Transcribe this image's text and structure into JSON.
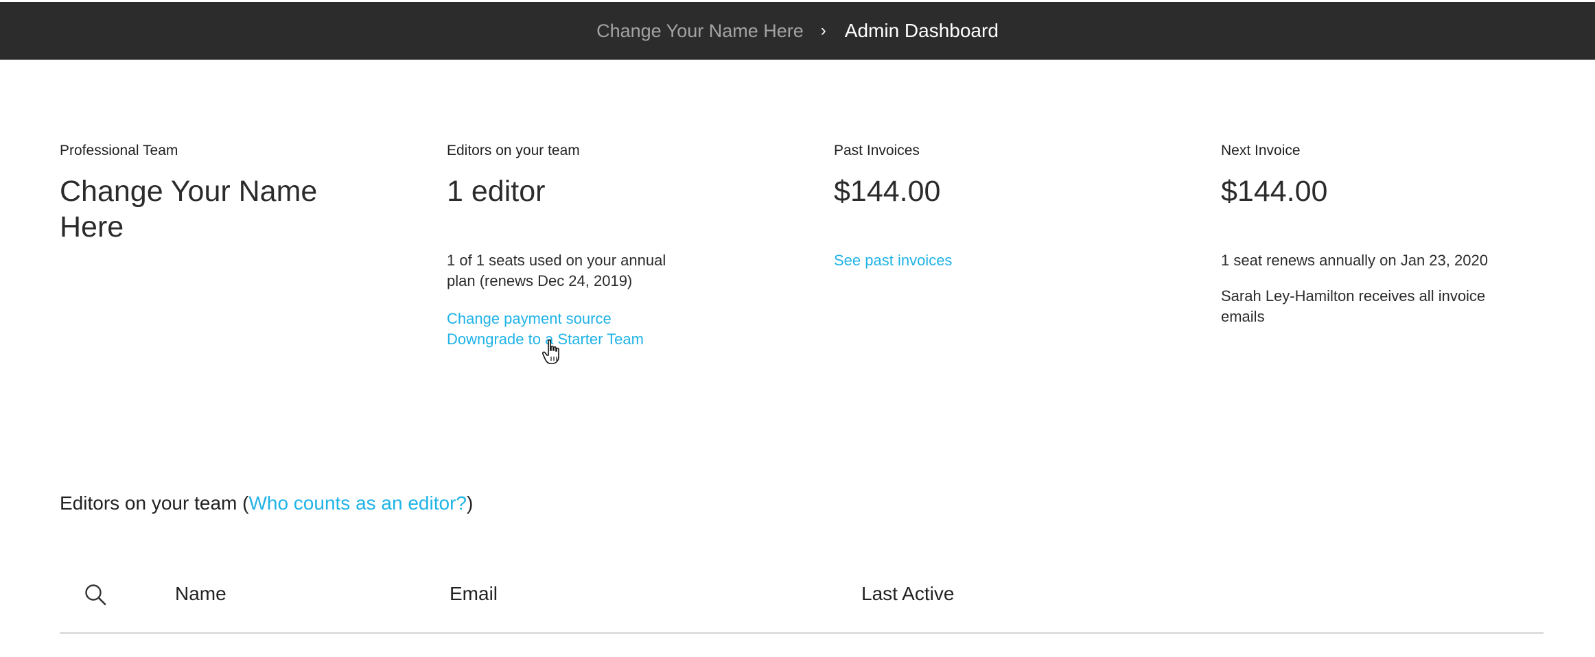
{
  "topbar": {
    "parent": "Change Your Name Here",
    "separator": "›",
    "current": "Admin Dashboard"
  },
  "summary": {
    "team": {
      "label": "Professional Team",
      "name": "Change Your Name Here"
    },
    "editors": {
      "label": "Editors on your team",
      "value": "1 editor",
      "seats_text": "1 of 1 seats used on your annual plan (renews Dec 24, 2019)",
      "change_payment_link": "Change payment source",
      "downgrade_link": "Downgrade to a Starter Team"
    },
    "past_invoices": {
      "label": "Past Invoices",
      "value": "$144.00",
      "see_link": "See past invoices"
    },
    "next_invoice": {
      "label": "Next Invoice",
      "value": "$144.00",
      "renew_text": "1 seat renews annually on Jan 23, 2020",
      "email_text": "Sarah Ley-Hamilton receives all invoice emails"
    }
  },
  "editors_section": {
    "heading_prefix": "Editors on your team (",
    "heading_link": "Who counts as an editor?",
    "heading_suffix": ")"
  },
  "table": {
    "columns": [
      "Name",
      "Email",
      "Last Active"
    ],
    "search_icon": "search-icon"
  },
  "colors": {
    "topbar_bg": "#2c2c2c",
    "link": "#1fb3e6",
    "divider": "#d4d4d4"
  }
}
